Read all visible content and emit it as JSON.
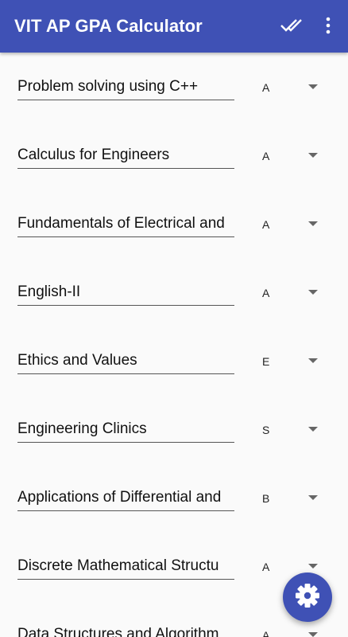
{
  "app_bar": {
    "title": "VIT AP GPA Calculator",
    "background_color": "#3f51b5",
    "done_icon": "done-all-icon",
    "more_icon": "more-vert-icon"
  },
  "courses": [
    {
      "name": "Problem solving using C++",
      "grade": "A"
    },
    {
      "name": "Calculus for Engineers",
      "grade": "A"
    },
    {
      "name": "Fundamentals of Electrical and",
      "grade": "A"
    },
    {
      "name": "English-II",
      "grade": "A"
    },
    {
      "name": "Ethics and Values",
      "grade": "E"
    },
    {
      "name": "Engineering Clinics",
      "grade": "S"
    },
    {
      "name": "Applications of Differential and",
      "grade": "B"
    },
    {
      "name": "Discrete Mathematical Structu",
      "grade": "A"
    },
    {
      "name": "Data Structures and Algorithm",
      "grade": "A"
    }
  ],
  "fab": {
    "icon": "settings-gear-icon",
    "color": "#3f51b5"
  }
}
